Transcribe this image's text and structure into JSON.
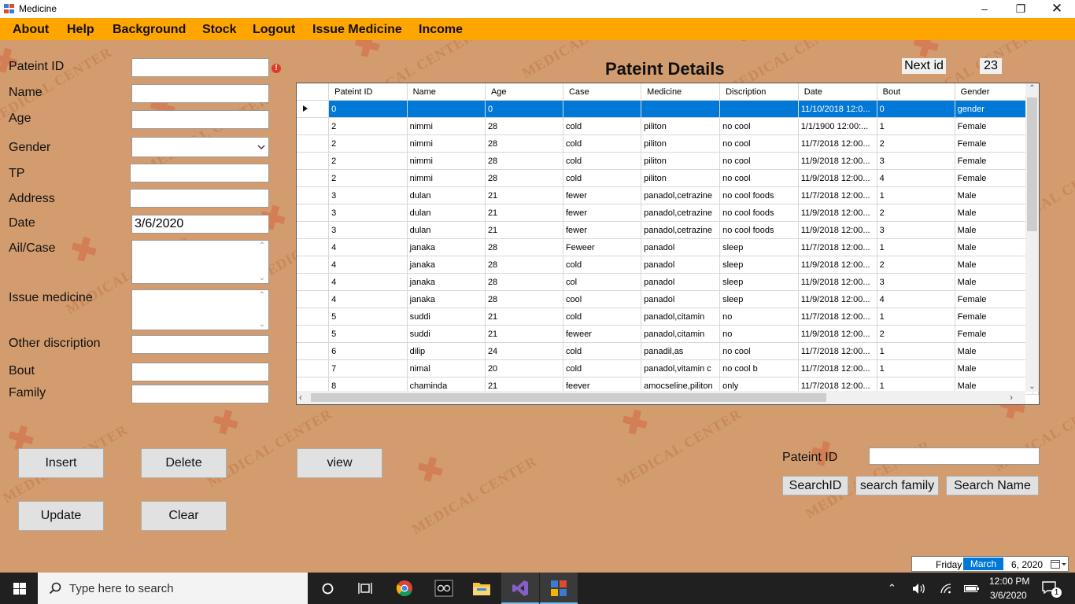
{
  "window": {
    "title": "Medicine"
  },
  "menu": [
    "About",
    "Help",
    "Background",
    "Stock",
    "Logout",
    "Issue Medicine",
    "Income"
  ],
  "watermark": "MEDICAL CENTER",
  "form": {
    "labels": {
      "patient_id": "Pateint ID",
      "name": "Name",
      "age": "Age",
      "gender": "Gender",
      "tp": "TP",
      "address": "Address",
      "date": "Date",
      "ail_case": "Ail/Case",
      "issue_medicine": "Issue medicine",
      "other_discription": "Other discription",
      "bout": "Bout",
      "family": "Family"
    },
    "values": {
      "patient_id": "",
      "name": "",
      "age": "",
      "gender": "",
      "tp": "",
      "address": "",
      "date": "3/6/2020",
      "ail_case": "",
      "issue_medicine": "",
      "other_discription": "",
      "bout": "",
      "family": ""
    }
  },
  "details": {
    "heading": "Pateint Details",
    "next_id_label": "Next id",
    "next_id_value": "23"
  },
  "grid": {
    "columns": [
      "Pateint ID",
      "Name",
      "Age",
      "Case",
      "Medicine",
      "Discription",
      "Date",
      "Bout",
      "Gender"
    ],
    "rows": [
      [
        "0",
        "",
        "0",
        "",
        "",
        "",
        "11/10/2018 12:0...",
        "0",
        "gender"
      ],
      [
        "2",
        "nimmi",
        "28",
        "cold",
        "piliton",
        "no cool",
        "1/1/1900 12:00:...",
        "1",
        "Female"
      ],
      [
        "2",
        "nimmi",
        "28",
        "cold",
        "piliton",
        "no cool",
        "11/7/2018 12:00...",
        "2",
        "Female"
      ],
      [
        "2",
        "nimmi",
        "28",
        "cold",
        "piliton",
        "no cool",
        "11/9/2018 12:00...",
        "3",
        "Female"
      ],
      [
        "2",
        "nimmi",
        "28",
        "cold",
        "piliton",
        "no cool",
        "11/9/2018 12:00...",
        "4",
        "Female"
      ],
      [
        "3",
        "dulan",
        "21",
        "fewer",
        "panadol,cetrazine",
        "no cool foods",
        "11/7/2018 12:00...",
        "1",
        "Male"
      ],
      [
        "3",
        "dulan",
        "21",
        "fewer",
        "panadol,cetrazine",
        "no cool foods",
        "11/9/2018 12:00...",
        "2",
        "Male"
      ],
      [
        "3",
        "dulan",
        "21",
        "fewer",
        "panadol,cetrazine",
        "no cool foods",
        "11/9/2018 12:00...",
        "3",
        "Male"
      ],
      [
        "4",
        "janaka",
        "28",
        "Feweer",
        "panadol",
        "sleep",
        "11/7/2018 12:00...",
        "1",
        "Male"
      ],
      [
        "4",
        "janaka",
        "28",
        "cold",
        "panadol",
        "sleep",
        "11/9/2018 12:00...",
        "2",
        "Male"
      ],
      [
        "4",
        "janaka",
        "28",
        "col",
        "panadol",
        "sleep",
        "11/9/2018 12:00...",
        "3",
        "Male"
      ],
      [
        "4",
        "janaka",
        "28",
        "cool",
        "panadol",
        "sleep",
        "11/9/2018 12:00...",
        "4",
        "Female"
      ],
      [
        "5",
        "suddi",
        "21",
        "cold",
        "panadol,citamin",
        "no",
        "11/7/2018 12:00...",
        "1",
        "Female"
      ],
      [
        "5",
        "suddi",
        "21",
        "feweer",
        "panadol,citamin",
        "no",
        "11/9/2018 12:00...",
        "2",
        "Female"
      ],
      [
        "6",
        "dilip",
        "24",
        "cold",
        "panadil,as",
        "no cool",
        "11/7/2018 12:00...",
        "1",
        "Male"
      ],
      [
        "7",
        "nimal",
        "20",
        "cold",
        "panadol,vitamin c",
        "no cool b",
        "11/7/2018 12:00...",
        "1",
        "Male"
      ],
      [
        "8",
        "chaminda",
        "21",
        "feever",
        "amocseline,piliton",
        "only",
        "11/7/2018 12:00...",
        "1",
        "Male"
      ]
    ],
    "selected_row": 0
  },
  "buttons": {
    "insert": "Insert",
    "delete": "Delete",
    "view": "view",
    "update": "Update",
    "clear": "Clear"
  },
  "search": {
    "label": "Pateint ID",
    "value": "",
    "search_id": "SearchID",
    "search_family": "search family",
    "search_name": "Search Name"
  },
  "date_picker": {
    "day": "Friday",
    "sep": ",",
    "month": "March",
    "rest": "6, 2020"
  },
  "taskbar": {
    "search_placeholder": "Type here to search",
    "time": "12:00 PM",
    "date": "3/6/2020",
    "notification_count": "1"
  },
  "colors": {
    "menu_bar": "#ffa500",
    "background": "#d29c6e",
    "selection": "#0078d7",
    "taskbar": "#202020"
  }
}
